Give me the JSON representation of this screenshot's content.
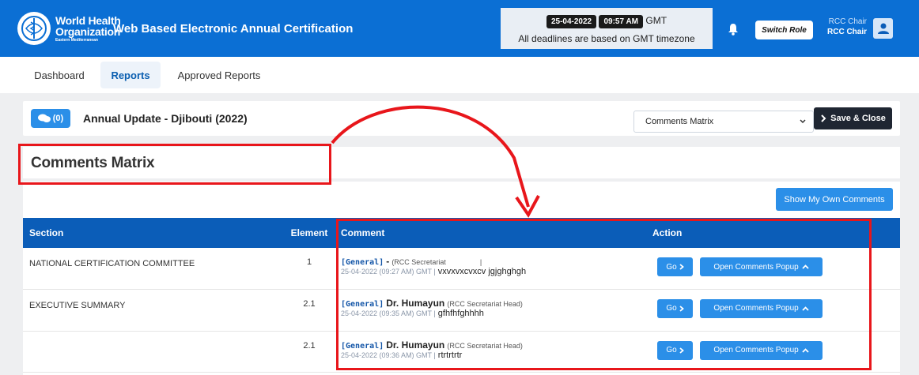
{
  "header": {
    "org_line1": "World Health",
    "org_line2": "Organization",
    "org_line3": "Eastern Mediterranean",
    "app_title": "Web Based Electronic Annual Certification",
    "date": "25-04-2022",
    "time": "09:57 AM",
    "timezone": "GMT",
    "deadline_note": "All deadlines are based on GMT timezone",
    "switch_role_label": "Switch Role",
    "role_line1": "RCC Chair",
    "role_line2": "RCC Chair",
    "bell_icon": "bell-icon",
    "user_icon": "user-icon"
  },
  "tabs": [
    {
      "label": "Dashboard",
      "active": false
    },
    {
      "label": "Reports",
      "active": true
    },
    {
      "label": "Approved Reports",
      "active": false
    }
  ],
  "toolbar": {
    "comment_count": "(0)",
    "doc_title": "Annual Update - Djibouti (2022)",
    "view_select_value": "Comments Matrix",
    "save_close_label": "Save & Close"
  },
  "matrix": {
    "title": "Comments Matrix",
    "own_comments_label": "Show My Own Comments",
    "columns": [
      "Section",
      "Element",
      "Comment",
      "Action"
    ],
    "rows": [
      {
        "section": "NATIONAL CERTIFICATION COMMITTEE",
        "element": "1",
        "tag": "[General]",
        "author": "-",
        "role": "(RCC Secretariat",
        "role_tail": "|",
        "date": "25-04-2022 (09:27 AM) GMT |",
        "text": "vxvxvxcvxcv jgjghghgh"
      },
      {
        "section": "EXECUTIVE SUMMARY",
        "element": "2.1",
        "tag": "[General]",
        "author": "Dr. Humayun",
        "role": "(RCC Secretariat Head)",
        "role_tail": "",
        "date": "25-04-2022 (09:35 AM) GMT |",
        "text": "gfhfhfghhhh"
      },
      {
        "section": "",
        "element": "2.1",
        "tag": "[General]",
        "author": "Dr. Humayun",
        "role": "(RCC Secretariat Head)",
        "role_tail": "",
        "date": "25-04-2022 (09:36 AM) GMT |",
        "text": "rtrtrtrtr"
      }
    ],
    "go_label": "Go",
    "open_popup_label": "Open Comments Popup"
  },
  "colors": {
    "brand_blue": "#0b6fd4",
    "table_header": "#0b5db8",
    "button_blue": "#2b8fe8",
    "annotation_red": "#e8161b"
  }
}
